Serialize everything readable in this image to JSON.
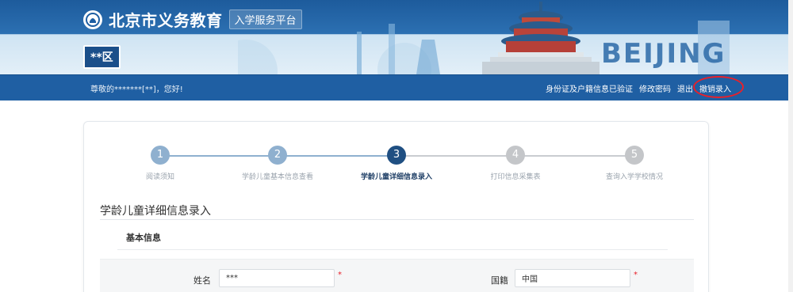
{
  "header": {
    "platform_name": "北京市义务教育",
    "platform_sub": "入学服务平台",
    "district": "**区",
    "banner_word": "BEIJING"
  },
  "navbar": {
    "greeting": "尊敬的*******[**]，您好!",
    "links": {
      "id_verified": "身份证及户籍信息已验证",
      "change_password": "修改密码",
      "logout": "退出",
      "cancel_entry": "撤销录入"
    }
  },
  "steps": [
    {
      "number": "1",
      "label": "阅读须知",
      "state": "past"
    },
    {
      "number": "2",
      "label": "学龄儿童基本信息查看",
      "state": "past"
    },
    {
      "number": "3",
      "label": "学龄儿童详细信息录入",
      "state": "current"
    },
    {
      "number": "4",
      "label": "打印信息采集表",
      "state": "future"
    },
    {
      "number": "5",
      "label": "查询入学学校情况",
      "state": "future"
    }
  ],
  "main": {
    "section_title": "学龄儿童详细信息录入",
    "subsection_title": "基本信息"
  },
  "form": {
    "name_label": "姓名",
    "name_value": "***",
    "nationality_label": "国籍",
    "nationality_value": "中国",
    "required_mark": "*"
  },
  "colors": {
    "brand_blue": "#1f5fa3",
    "current_step": "#1f4f82",
    "required_red": "#e8202a",
    "highlight_ring": "#e8202a"
  }
}
